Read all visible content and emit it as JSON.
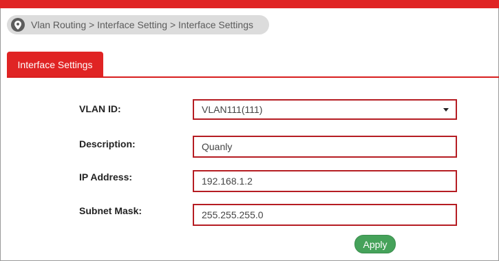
{
  "breadcrumb": {
    "icon": "location-pin-icon",
    "text": "Vlan Routing > Interface Setting  > Interface Settings"
  },
  "tabs": [
    {
      "label": "Interface Settings",
      "active": true
    }
  ],
  "form": {
    "vlan_id": {
      "label": "VLAN ID:",
      "selected": "VLAN111(111)"
    },
    "description": {
      "label": "Description:",
      "value": "Quanly"
    },
    "ip_address": {
      "label": "IP Address:",
      "value": "192.168.1.2"
    },
    "subnet_mask": {
      "label": "Subnet Mask:",
      "value": "255.255.255.0"
    }
  },
  "actions": {
    "apply_label": "Apply"
  },
  "colors": {
    "accent": "#e02424",
    "field_border": "#b51c22",
    "apply_button": "#45a25a",
    "breadcrumb_bg": "#dcdcdc"
  }
}
